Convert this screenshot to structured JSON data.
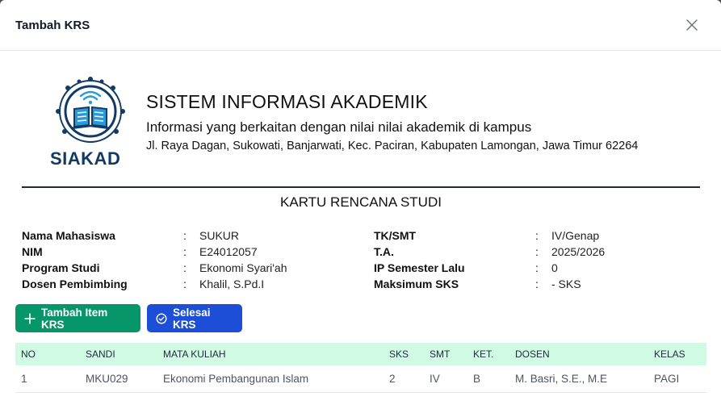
{
  "modal": {
    "title": "Tambah KRS"
  },
  "header": {
    "logo_text": "SIAKAD",
    "title": "SISTEM INFORMASI AKADEMIK",
    "subtitle": "Informasi yang berkaitan dengan nilai nilai akademik di kampus",
    "address": "Jl. Raya Dagan, Sukowati, Banjarwati, Kec. Paciran, Kabupaten Lamongan, Jawa Timur 62264"
  },
  "document": {
    "title": "KARTU RENCANA STUDI"
  },
  "student_info": {
    "left": [
      {
        "label": "Nama Mahasiswa",
        "value": "SUKUR"
      },
      {
        "label": "NIM",
        "value": "E24012057"
      },
      {
        "label": "Program Studi",
        "value": "Ekonomi Syari'ah"
      },
      {
        "label": "Dosen Pembimbing",
        "value": "Khalil, S.Pd.I"
      }
    ],
    "right": [
      {
        "label": "TK/SMT",
        "value": "IV/Genap"
      },
      {
        "label": "T.A.",
        "value": "2025/2026"
      },
      {
        "label": "IP Semester Lalu",
        "value": "0"
      },
      {
        "label": "Maksimum SKS",
        "value": "- SKS"
      }
    ],
    "separator": ":"
  },
  "actions": {
    "add_item": "Tambah Item KRS",
    "finish": "Selesai KRS"
  },
  "table": {
    "headers": {
      "no": "NO",
      "sandi": "SANDI",
      "mata_kuliah": "MATA KULIAH",
      "sks": "SKS",
      "smt": "SMT",
      "ket": "KET.",
      "dosen": "DOSEN",
      "kelas": "KELAS"
    },
    "rows": [
      {
        "no": "1",
        "sandi": "MKU029",
        "mata_kuliah": "Ekonomi Pembangunan Islam",
        "sks": "2",
        "smt": "IV",
        "ket": "B",
        "dosen": "M. Basri, S.E., M.E",
        "kelas": "PAGI"
      }
    ]
  },
  "colors": {
    "green_button": "#079669",
    "blue_button": "#1d4ed8",
    "table_header_bg": "#d1fae5",
    "logo_navy": "#123a63"
  },
  "icons": {
    "close": "close-icon",
    "add": "plus-icon",
    "finish": "check-circle-icon",
    "logo": "book-wifi-circuit-logo"
  }
}
